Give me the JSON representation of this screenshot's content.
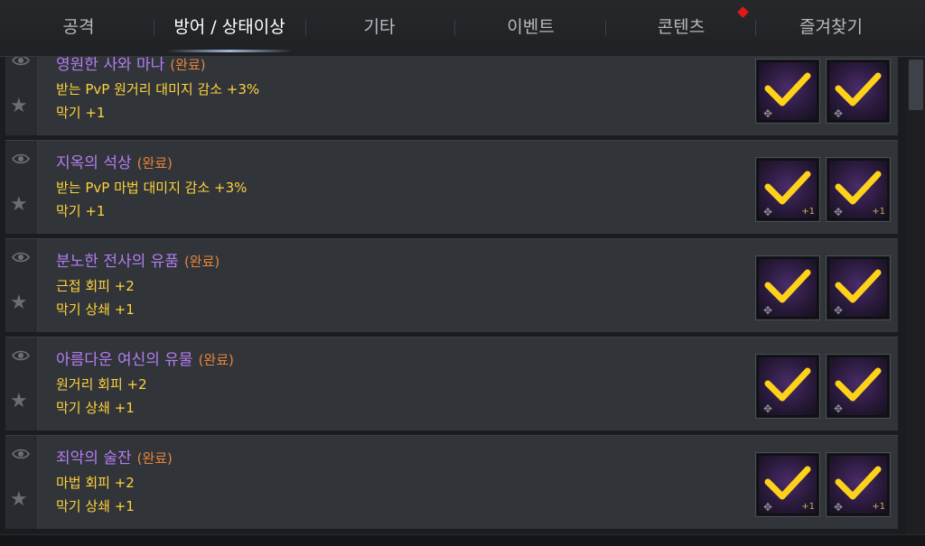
{
  "tabs": [
    {
      "label": "공격",
      "active": false
    },
    {
      "label": "방어 / 상태이상",
      "active": true
    },
    {
      "label": "기타",
      "active": false
    },
    {
      "label": "이벤트",
      "active": false
    },
    {
      "label": "콘텐츠",
      "active": false,
      "new": true
    },
    {
      "label": "즐겨찾기",
      "active": false
    }
  ],
  "entries": [
    {
      "title": "영원한 사와 마나",
      "status": "(완료)",
      "stats": [
        "받는 PvP 원거리 대미지 감소 +3%",
        "막기 +1"
      ],
      "slots": [
        {
          "icon": "gear-item-icon",
          "count": ""
        },
        {
          "icon": "gear-item-icon",
          "count": ""
        }
      ]
    },
    {
      "title": "지옥의 석상",
      "status": "(완료)",
      "stats": [
        "받는 PvP 마법 대미지 감소 +3%",
        "막기 +1"
      ],
      "slots": [
        {
          "icon": "gear-item-icon",
          "count": "+1"
        },
        {
          "icon": "gear-item-icon",
          "count": "+1"
        }
      ]
    },
    {
      "title": "분노한 전사의 유품",
      "status": "(완료)",
      "stats": [
        "근접 회피 +2",
        "막기 상쇄 +1"
      ],
      "slots": [
        {
          "icon": "gear-item-icon",
          "count": ""
        },
        {
          "icon": "gear-item-icon",
          "count": ""
        }
      ]
    },
    {
      "title": "아름다운 여신의 유물",
      "status": "(완료)",
      "stats": [
        "원거리 회피 +2",
        "막기 상쇄 +1"
      ],
      "slots": [
        {
          "icon": "gear-item-icon",
          "count": ""
        },
        {
          "icon": "gear-item-icon",
          "count": ""
        }
      ]
    },
    {
      "title": "죄악의 술잔",
      "status": "(완료)",
      "stats": [
        "마법 회피 +2",
        "막기 상쇄 +1"
      ],
      "slots": [
        {
          "icon": "gear-item-icon",
          "count": "+1"
        },
        {
          "icon": "gear-item-icon",
          "count": "+1"
        }
      ]
    }
  ],
  "colors": {
    "title": "#b37cf0",
    "status": "#e8843a",
    "stat": "#ffd23a",
    "check": "#ffd21a",
    "new_dot": "#e01818"
  }
}
